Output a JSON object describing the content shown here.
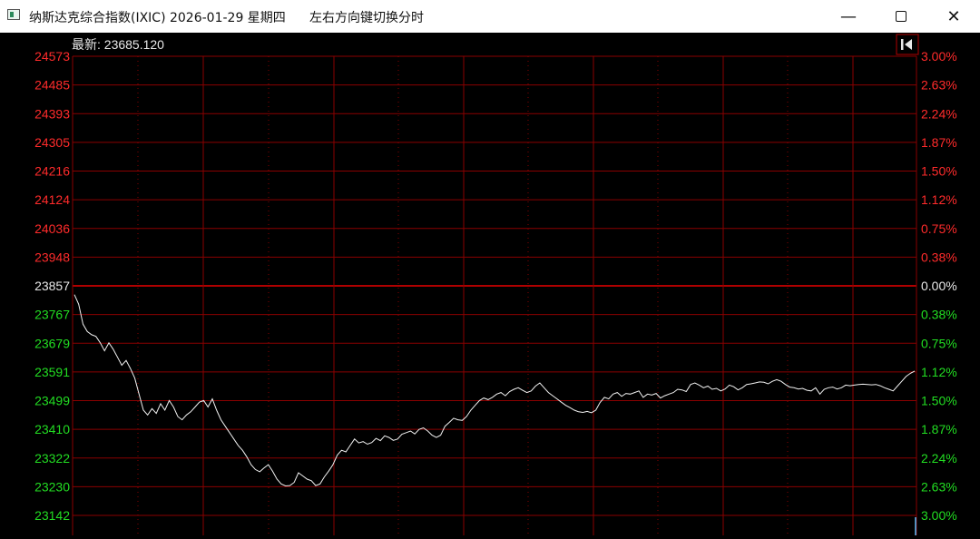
{
  "window": {
    "title": "纳斯达克综合指数(IXIC) 2026-01-29 星期四",
    "hint": "左右方向键切换分时",
    "minimize": "—",
    "close": "✕"
  },
  "header": {
    "latest_label": "最新: 23685.120"
  },
  "colors": {
    "up": "#ff2b2b",
    "down": "#22dd22",
    "neutral": "#e8e8e8",
    "grid": "#8a0000",
    "line": "#f2f2f2"
  },
  "chart_data": {
    "type": "line",
    "title": "",
    "x": [
      0,
      2,
      4,
      6,
      8,
      10,
      12,
      14,
      16,
      18,
      20,
      22,
      24,
      26,
      28,
      30,
      32,
      34,
      36,
      38,
      40,
      42,
      44,
      46,
      48,
      50,
      52,
      54,
      56,
      58,
      60,
      62,
      64,
      66,
      68,
      70,
      72,
      74,
      76,
      78,
      80,
      82,
      84,
      86,
      88,
      90,
      92,
      94,
      96,
      98,
      100,
      102,
      104,
      106,
      108,
      110,
      112,
      114,
      116,
      118,
      120,
      122,
      124,
      126,
      128,
      130,
      132,
      134,
      136,
      138,
      140,
      142,
      144,
      146,
      148,
      150,
      152,
      154,
      156,
      158,
      160,
      162,
      164,
      166,
      168,
      170,
      172,
      174,
      176,
      178,
      180,
      182,
      184,
      186,
      188,
      190,
      192,
      194,
      196,
      198,
      200,
      202,
      204,
      206,
      208,
      210,
      212,
      214,
      216,
      218,
      220,
      222,
      224,
      226,
      228,
      230,
      232,
      234,
      236,
      238,
      240,
      242,
      244,
      246,
      248,
      250,
      252,
      254,
      256,
      258,
      260,
      262,
      264,
      266,
      268,
      270,
      272,
      274,
      276,
      278,
      280,
      282,
      284,
      286,
      288,
      290,
      292,
      294,
      296,
      298,
      300,
      302,
      304,
      306,
      308,
      310,
      312,
      314,
      316,
      318,
      320,
      322,
      324,
      326,
      328,
      330,
      332,
      334,
      336,
      338,
      340,
      342,
      344,
      346,
      348,
      350,
      352,
      354,
      356,
      358,
      360,
      362,
      364,
      366,
      368,
      370,
      372,
      374,
      376,
      378,
      380,
      382,
      384,
      386,
      388,
      390
    ],
    "y": [
      23830,
      23800,
      23738,
      23715,
      23705,
      23700,
      23680,
      23655,
      23680,
      23660,
      23635,
      23610,
      23625,
      23600,
      23570,
      23520,
      23470,
      23455,
      23475,
      23460,
      23490,
      23470,
      23500,
      23480,
      23450,
      23440,
      23455,
      23465,
      23480,
      23495,
      23500,
      23480,
      23505,
      23470,
      23440,
      23420,
      23400,
      23380,
      23360,
      23345,
      23325,
      23300,
      23285,
      23278,
      23290,
      23300,
      23280,
      23255,
      23240,
      23234,
      23235,
      23245,
      23275,
      23265,
      23255,
      23250,
      23235,
      23240,
      23262,
      23280,
      23300,
      23330,
      23345,
      23340,
      23360,
      23380,
      23368,
      23372,
      23364,
      23369,
      23382,
      23375,
      23390,
      23385,
      23376,
      23380,
      23395,
      23400,
      23405,
      23396,
      23410,
      23415,
      23405,
      23392,
      23385,
      23392,
      23420,
      23432,
      23445,
      23440,
      23438,
      23450,
      23470,
      23485,
      23500,
      23508,
      23503,
      23510,
      23520,
      23525,
      23515,
      23528,
      23535,
      23540,
      23532,
      23525,
      23530,
      23545,
      23555,
      23540,
      23525,
      23515,
      23505,
      23495,
      23485,
      23478,
      23470,
      23465,
      23463,
      23466,
      23462,
      23470,
      23494,
      23510,
      23505,
      23520,
      23525,
      23513,
      23522,
      23520,
      23525,
      23530,
      23510,
      23520,
      23517,
      23522,
      23508,
      23515,
      23520,
      23525,
      23535,
      23533,
      23528,
      23550,
      23555,
      23548,
      23540,
      23545,
      23535,
      23538,
      23530,
      23536,
      23548,
      23543,
      23533,
      23540,
      23550,
      23552,
      23555,
      23558,
      23557,
      23552,
      23560,
      23565,
      23560,
      23550,
      23542,
      23540,
      23536,
      23538,
      23532,
      23530,
      23540,
      23520,
      23535,
      23540,
      23542,
      23536,
      23540,
      23548,
      23546,
      23548,
      23550,
      23551,
      23550,
      23549,
      23550,
      23546,
      23540,
      23535,
      23530,
      23545,
      23560,
      23575,
      23585,
      23592,
      23595,
      23590,
      23600,
      23630,
      23655,
      23680,
      23680
    ],
    "ylim": [
      23142,
      24573
    ],
    "y_ticks": [
      "24573",
      "24485",
      "24393",
      "24305",
      "24216",
      "24124",
      "24036",
      "23948",
      "23857",
      "23767",
      "23679",
      "23591",
      "23499",
      "23410",
      "23322",
      "23230",
      "23142"
    ],
    "pct_ticks": [
      "3.00%",
      "2.63%",
      "2.24%",
      "1.87%",
      "1.50%",
      "1.12%",
      "0.75%",
      "0.38%",
      "0.00%",
      "0.38%",
      "0.75%",
      "1.12%",
      "1.50%",
      "1.87%",
      "2.24%",
      "2.63%",
      "3.00%"
    ],
    "reference": 23857,
    "grid": true,
    "legend": "none"
  }
}
